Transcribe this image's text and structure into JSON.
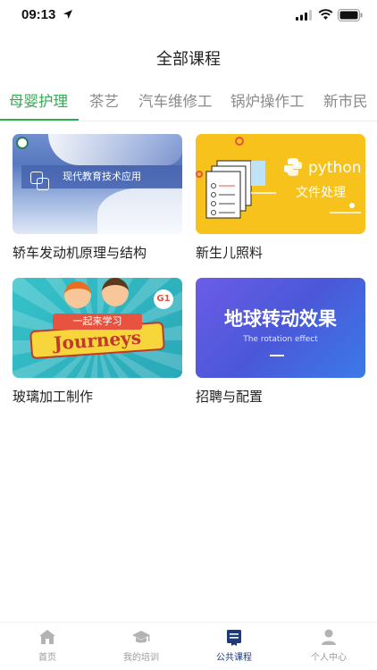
{
  "status_bar": {
    "time": "09:13"
  },
  "header": {
    "title": "全部课程"
  },
  "tabs": [
    {
      "label": "母婴护理",
      "active": true
    },
    {
      "label": "茶艺",
      "active": false
    },
    {
      "label": "汽车维修工",
      "active": false
    },
    {
      "label": "锅炉操作工",
      "active": false
    },
    {
      "label": "新市民",
      "active": false
    }
  ],
  "courses": [
    {
      "title": "轿车发动机原理与结构",
      "thumb_text": "现代教育技术应用"
    },
    {
      "title": "新生儿照料",
      "thumb_text": "python",
      "thumb_sub": "文件处理"
    },
    {
      "title": "玻璃加工制作",
      "thumb_text": "Journeys",
      "thumb_ribbon": "一起来学习",
      "thumb_badge": "G1"
    },
    {
      "title": "招聘与配置",
      "thumb_text": "地球转动效果",
      "thumb_sub": "The rotation effect"
    }
  ],
  "bottom_nav": [
    {
      "label": "首页",
      "icon": "home-icon",
      "active": false
    },
    {
      "label": "我的培训",
      "icon": "graduation-cap-icon",
      "active": false
    },
    {
      "label": "公共课程",
      "icon": "book-icon",
      "active": true
    },
    {
      "label": "个人中心",
      "icon": "person-icon",
      "active": false
    }
  ],
  "colors": {
    "accent": "#35a853",
    "nav_active": "#1f3a7a",
    "inactive": "#9a9a9a"
  }
}
